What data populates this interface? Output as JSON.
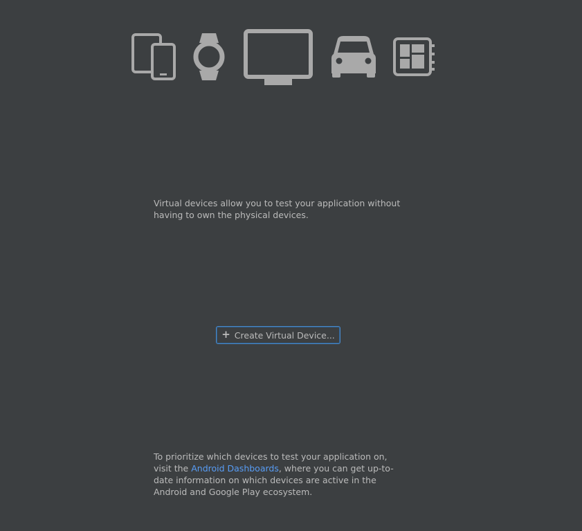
{
  "device_icons": [
    {
      "icon": "phone-tablet-icon",
      "label": "Phone and Tablet"
    },
    {
      "icon": "wear-watch-icon",
      "label": "Wear OS"
    },
    {
      "icon": "tv-icon",
      "label": "TV"
    },
    {
      "icon": "car-icon",
      "label": "Automotive"
    },
    {
      "icon": "things-board-icon",
      "label": "Android Things"
    }
  ],
  "description": "Virtual devices allow you to test your application without having to own the physical devices.",
  "create_button": {
    "icon": "plus-icon",
    "label": "Create Virtual Device..."
  },
  "footer": {
    "text_before_link": "To prioritize which devices to test your application on, visit the ",
    "link_text": "Android Dashboards",
    "text_after_link": ", where you can get up-to-date information on which devices are active in the Android and Google Play ecosystem."
  },
  "colors": {
    "background": "#3c3f41",
    "text": "#bbbbbb",
    "icon": "#a9a9a9",
    "link": "#589df6",
    "button_focus_border": "#4a88c7"
  }
}
